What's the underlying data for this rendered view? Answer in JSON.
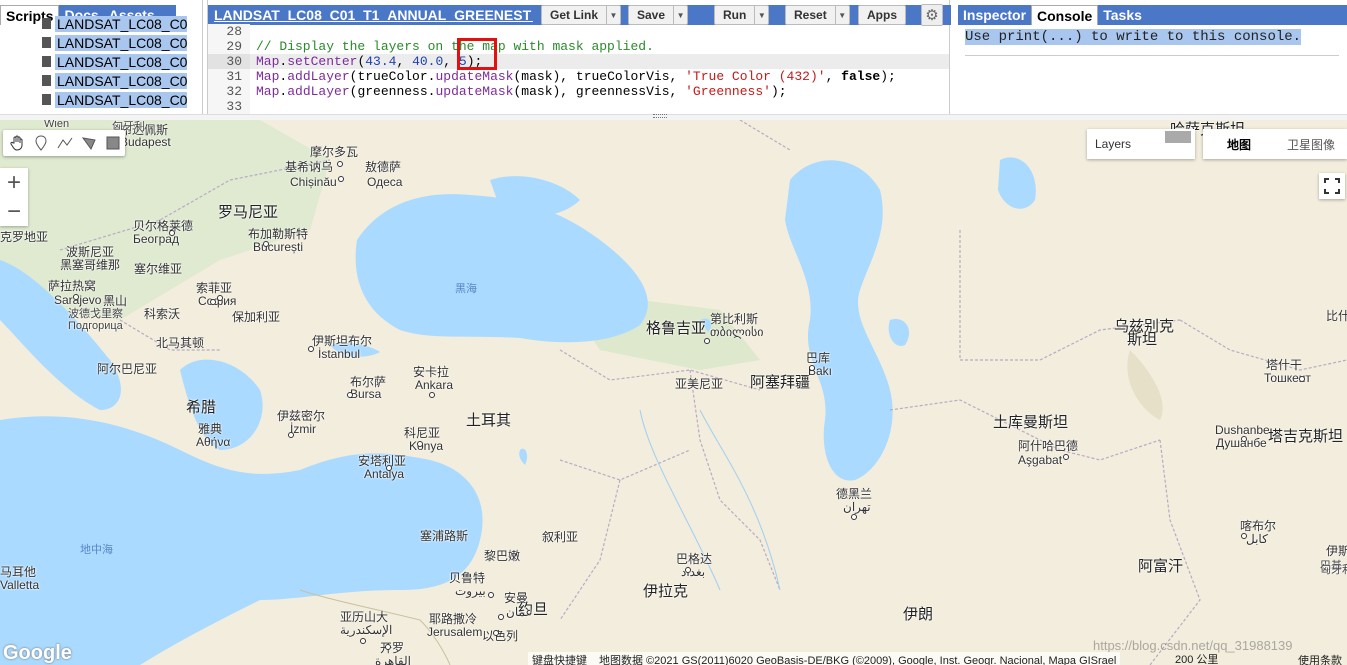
{
  "left_panel": {
    "tabs": [
      "Scripts",
      "Docs",
      "Assets"
    ],
    "files": [
      "LANDSAT_LC08_C0...",
      "LANDSAT_LC08_C0...",
      "LANDSAT_LC08_C0...",
      "LANDSAT_LC08_C0...",
      "LANDSAT_LC08_C0..."
    ]
  },
  "editor": {
    "script_title": "LANDSAT_LC08_C01_T1_ANNUAL_GREENEST_T...",
    "buttons": {
      "get_link": "Get Link",
      "save": "Save",
      "run": "Run",
      "reset": "Reset",
      "apps": "Apps"
    },
    "lines": [
      {
        "n": "28",
        "segs": []
      },
      {
        "n": "29",
        "segs": [
          {
            "t": "// Display the layers on the map with mask applied.",
            "c": "cm"
          }
        ]
      },
      {
        "n": "30",
        "segs": [
          {
            "t": "Map",
            "c": "kw"
          },
          {
            "t": ".",
            "c": ""
          },
          {
            "t": "setCenter",
            "c": "kw"
          },
          {
            "t": "(",
            "c": ""
          },
          {
            "t": "43.4",
            "c": "num"
          },
          {
            "t": ", ",
            "c": ""
          },
          {
            "t": "40.0",
            "c": "num"
          },
          {
            "t": ", ",
            "c": ""
          },
          {
            "t": "5",
            "c": "num"
          },
          {
            "t": ");",
            "c": ""
          }
        ]
      },
      {
        "n": "31",
        "segs": [
          {
            "t": "Map",
            "c": "kw"
          },
          {
            "t": ".",
            "c": ""
          },
          {
            "t": "addLayer",
            "c": "kw"
          },
          {
            "t": "(trueColor.",
            "c": ""
          },
          {
            "t": "updateMask",
            "c": "kw"
          },
          {
            "t": "(mask), trueColorVis, ",
            "c": ""
          },
          {
            "t": "'True Color (432)'",
            "c": "str"
          },
          {
            "t": ", ",
            "c": ""
          },
          {
            "t": "false",
            "c": "bd"
          },
          {
            "t": ");",
            "c": ""
          }
        ]
      },
      {
        "n": "32",
        "segs": [
          {
            "t": "Map",
            "c": "kw"
          },
          {
            "t": ".",
            "c": ""
          },
          {
            "t": "addLayer",
            "c": "kw"
          },
          {
            "t": "(greenness.",
            "c": ""
          },
          {
            "t": "updateMask",
            "c": "kw"
          },
          {
            "t": "(mask), greennessVis, ",
            "c": ""
          },
          {
            "t": "'Greenness'",
            "c": "str"
          },
          {
            "t": ");",
            "c": ""
          }
        ]
      },
      {
        "n": "33",
        "segs": []
      }
    ]
  },
  "right_panel": {
    "tabs": [
      "Inspector",
      "Console",
      "Tasks"
    ],
    "console_text": "Use print(...) to write to this console."
  },
  "map": {
    "layers_label": "Layers",
    "map_types": [
      "地图",
      "卫星图像"
    ],
    "labels": [
      {
        "t": "Wien"
      },
      {
        "t": "摩尔多瓦"
      },
      {
        "t": "基希讷乌"
      },
      {
        "t": "Chișinău"
      },
      {
        "t": "敖德萨"
      },
      {
        "t": "Одеса"
      },
      {
        "t": "匈牙利"
      },
      {
        "t": "罗马尼亚"
      },
      {
        "t": "贝尔格莱德"
      },
      {
        "t": "Београд"
      },
      {
        "t": "布加勒斯特"
      },
      {
        "t": "București"
      },
      {
        "t": "克罗地亚"
      },
      {
        "t": "波斯尼亚"
      },
      {
        "t": "黑塞哥维那"
      },
      {
        "t": "塞尔维亚"
      },
      {
        "t": "萨拉热窝"
      },
      {
        "t": "Sarajevo"
      },
      {
        "t": "黑山"
      },
      {
        "t": "索菲亚"
      },
      {
        "t": "София"
      },
      {
        "t": "保加利亚"
      },
      {
        "t": "波德戈里察"
      },
      {
        "t": "Подгорица"
      },
      {
        "t": "科索沃"
      },
      {
        "t": "北马其顿"
      },
      {
        "t": "阿尔巴尼亚"
      },
      {
        "t": "希腊"
      },
      {
        "t": "雅典"
      },
      {
        "t": "Αθήνα"
      },
      {
        "t": "伊斯坦布尔"
      },
      {
        "t": "İstanbul"
      },
      {
        "t": "布尔萨"
      },
      {
        "t": "Bursa"
      },
      {
        "t": "安卡拉"
      },
      {
        "t": "Ankara"
      },
      {
        "t": "伊兹密尔"
      },
      {
        "t": "İzmir"
      },
      {
        "t": "土耳其"
      },
      {
        "t": "科尼亚"
      },
      {
        "t": "Konya"
      },
      {
        "t": "安塔利亚"
      },
      {
        "t": "Antalya"
      },
      {
        "t": "黑海"
      },
      {
        "t": "格鲁吉亚"
      },
      {
        "t": "第比利斯"
      },
      {
        "t": "თბილისი"
      },
      {
        "t": "亚美尼亚"
      },
      {
        "t": "阿塞拜疆"
      },
      {
        "t": "巴库"
      },
      {
        "t": "Bakı"
      },
      {
        "t": "哈萨克斯坦"
      },
      {
        "t": "乌兹别克"
      },
      {
        "t": "斯坦"
      },
      {
        "t": "塔什干"
      },
      {
        "t": "Тошкент"
      },
      {
        "t": "土库曼斯坦"
      },
      {
        "t": "阿什哈巴德"
      },
      {
        "t": "Aşgabat"
      },
      {
        "t": "Dushanbe"
      },
      {
        "t": "Душанбе"
      },
      {
        "t": "塔吉克斯坦"
      },
      {
        "t": "德黑兰"
      },
      {
        "t": "تهران"
      },
      {
        "t": "阿富汗"
      },
      {
        "t": "喀布尔"
      },
      {
        "t": "کابل"
      },
      {
        "t": "伊朗"
      },
      {
        "t": "伊拉克"
      },
      {
        "t": "巴格达"
      },
      {
        "t": "بغداد"
      },
      {
        "t": "叙利亚"
      },
      {
        "t": "塞浦路斯"
      },
      {
        "t": "黎巴嫩"
      },
      {
        "t": "贝鲁特"
      },
      {
        "t": "بيروت"
      },
      {
        "t": "安曼"
      },
      {
        "t": "约旦"
      },
      {
        "t": "عمان"
      },
      {
        "t": "耶路撒冷"
      },
      {
        "t": "Jerusalem"
      },
      {
        "t": "以色列"
      },
      {
        "t": "亚历山大"
      },
      {
        "t": "الإسكندرية"
      },
      {
        "t": "开罗"
      },
      {
        "t": "القاهرة"
      },
      {
        "t": "地中海"
      },
      {
        "t": "马耳他"
      },
      {
        "t": "Valletta"
      },
      {
        "t": "比什"
      },
      {
        "t": "伊斯兰"
      },
      {
        "t": "巴基"
      },
      {
        "t": "匈牙利"
      },
      {
        "t": "布达佩斯"
      },
      {
        "t": "Budapest"
      }
    ],
    "google": "Google",
    "attribution": [
      "键盘快捷键",
      "地图数据 ©2021 GS(2011)6020 GeoBasis-DE/BKG (©2009), Google, Inst. Geogr. Nacional, Mapa GISrael"
    ],
    "scale": "200 公里",
    "terms": "使用条款",
    "watermark": "https://blog.csdn.net/qq_31988139"
  },
  "colors": {
    "panel_blue": "#4b77c7",
    "water": "#aadaff",
    "land": "#f2eddc",
    "highlight": "#a8c6ee",
    "redbox": "#e41010"
  }
}
